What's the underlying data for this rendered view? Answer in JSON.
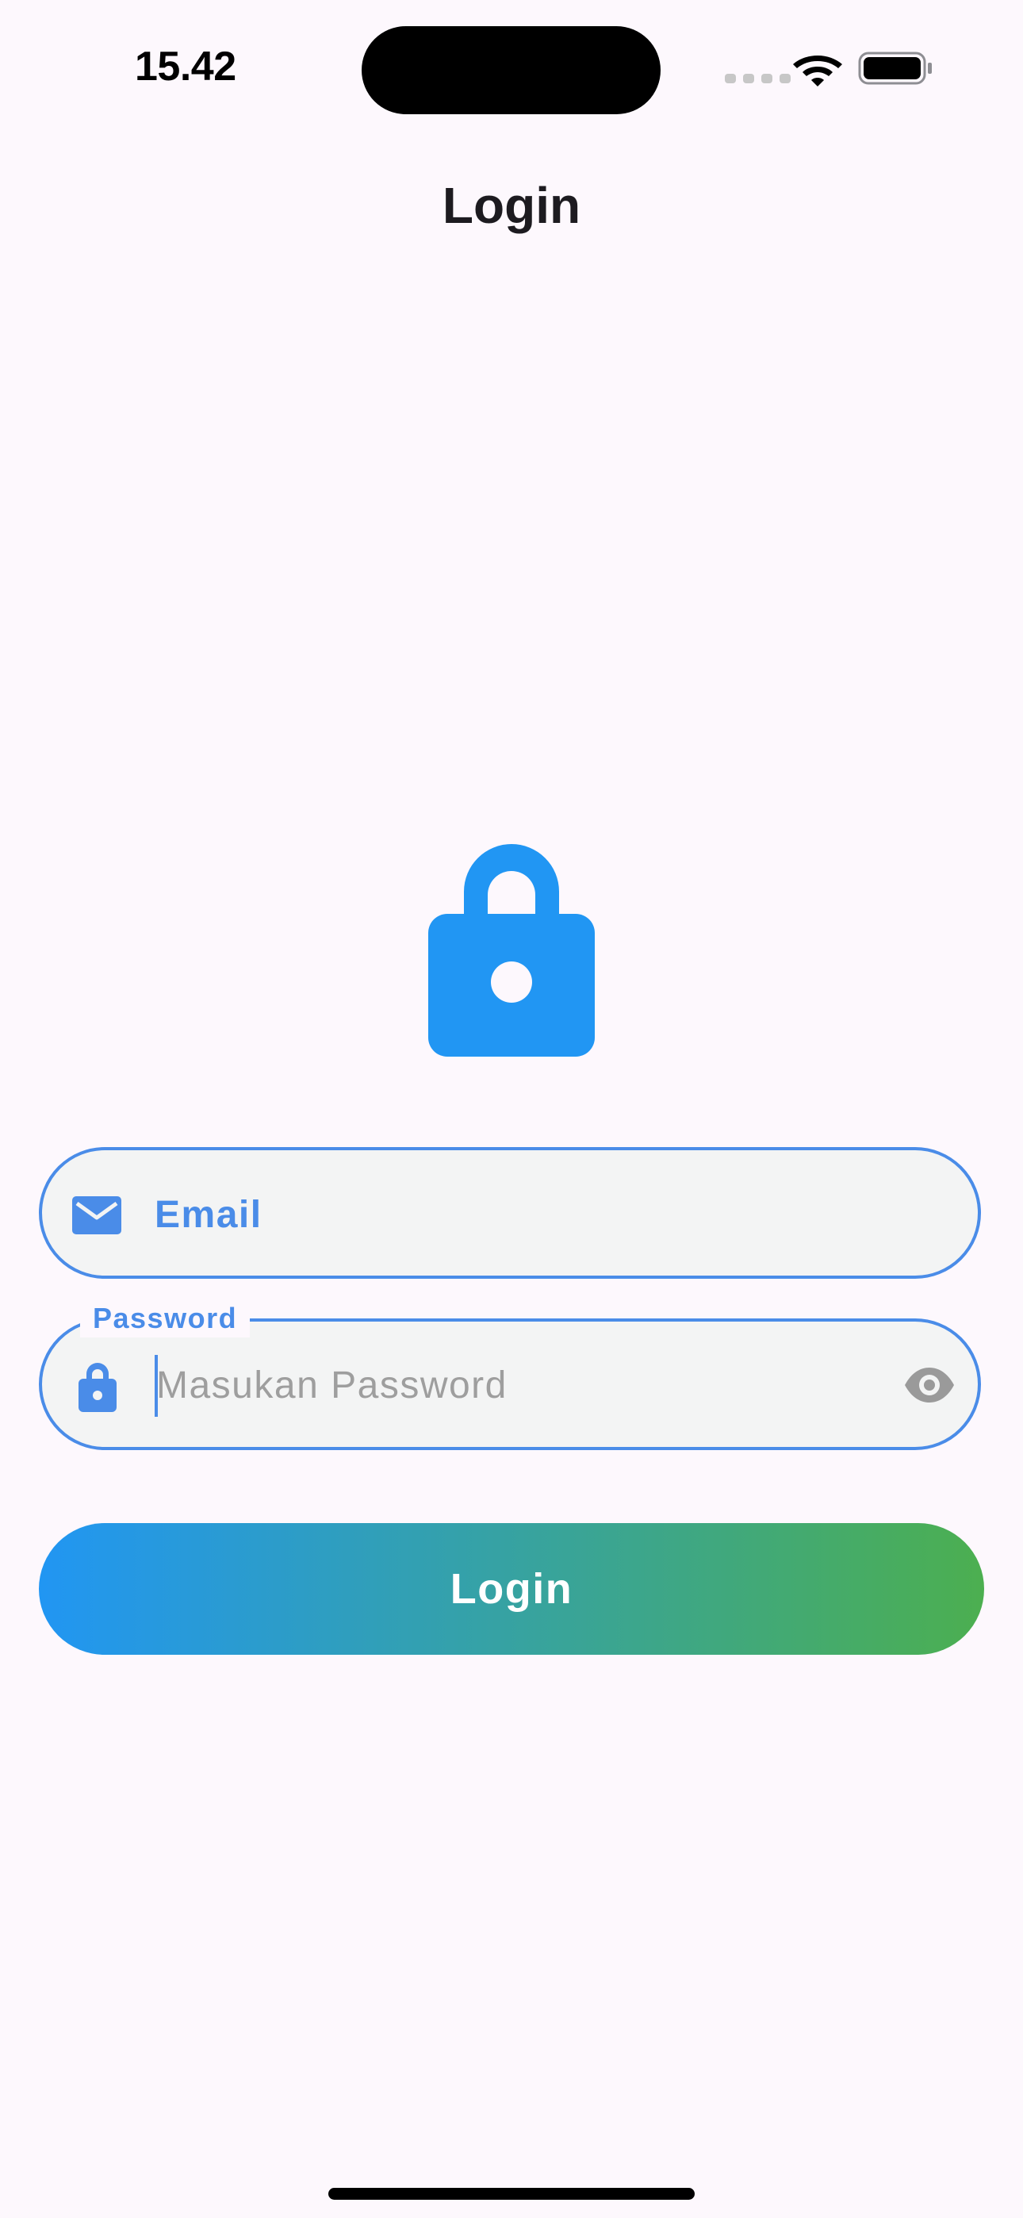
{
  "status_bar": {
    "time": "15.42"
  },
  "header": {
    "title": "Login"
  },
  "form": {
    "email": {
      "label": "Email",
      "icon": "mail-icon"
    },
    "password": {
      "label": "Password",
      "placeholder": "Masukan Password",
      "value": "",
      "icon": "lock-icon",
      "visibility_icon": "eye-icon"
    },
    "login_button_label": "Login"
  },
  "colors": {
    "background": "#fdf8fd",
    "accent": "#4a8ce8",
    "hero_lock": "#2196f3",
    "gradient_start": "#2196f3",
    "gradient_end": "#4caf50",
    "field_fill": "#f3f4f4"
  }
}
